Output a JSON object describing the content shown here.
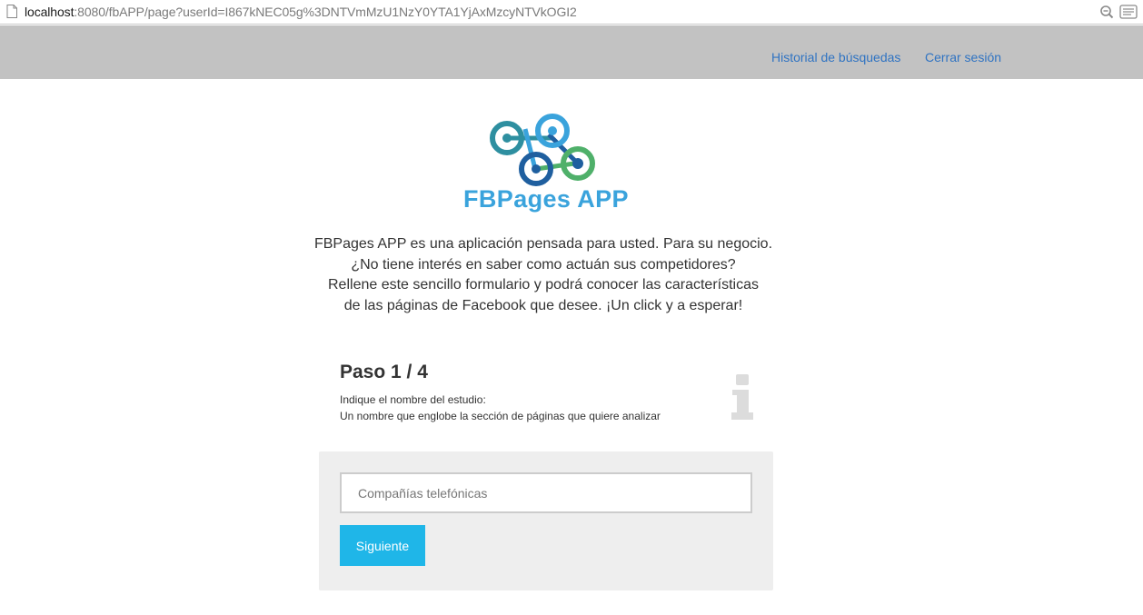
{
  "browser": {
    "url_host": "localhost",
    "url_rest": ":8080/fbAPP/page?userId=I867kNEC05g%3DNTVmMzU1NzY0YTA1YjAxMzcyNTVkOGI2",
    "icons": [
      "page-icon",
      "zoom-icon",
      "reader-icon"
    ]
  },
  "nav": {
    "history_label": "Historial de búsquedas",
    "logout_label": "Cerrar sesión",
    "link_color": "#2f73c2",
    "bar_color": "#c2c2c2"
  },
  "logo": {
    "text": "FBPages APP",
    "colors": [
      "#3aa3dc",
      "#2e8fa0",
      "#1f5f9f",
      "#4fb06a"
    ]
  },
  "intro": {
    "lines": [
      "FBPages APP es una aplicación pensada para usted. Para su negocio.",
      "¿No tiene interés en saber como actuán sus competidores?",
      "Rellene este sencillo formulario y podrá conocer las características",
      "de las páginas de Facebook que desee. ¡Un click y a esperar!"
    ]
  },
  "step": {
    "title": "Paso 1 / 4",
    "desc_line1": "Indique el nombre del estudio:",
    "desc_line2": "Un nombre que englobe la sección de páginas que quiere analizar",
    "icon": "info-icon"
  },
  "form": {
    "study_name_value": "",
    "study_name_placeholder": "Compañías telefónicas",
    "next_label": "Siguiente",
    "button_color": "#1fb6e8"
  }
}
